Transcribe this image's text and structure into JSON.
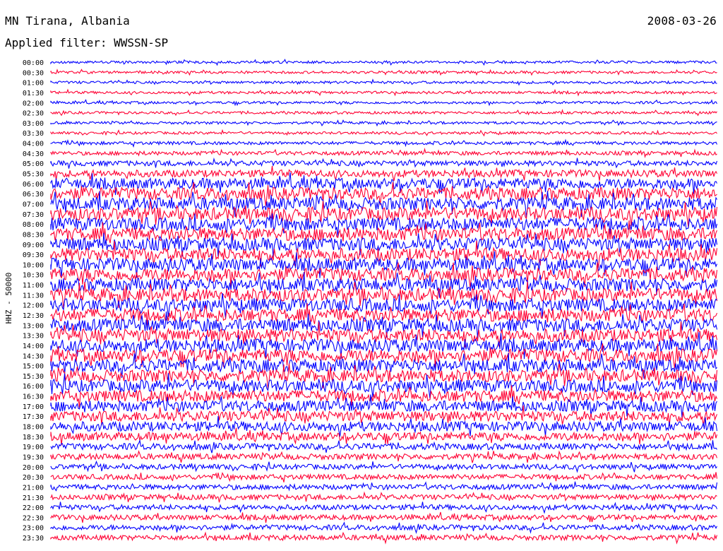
{
  "header": {
    "station": "MN Tirana, Albania",
    "date": "2008-03-26",
    "filter": "Applied filter: WWSSN-SP"
  },
  "chart_data": {
    "type": "helicorder",
    "channel_label": "HHZ - 50000",
    "row_labels": [
      "00:00",
      "00:30",
      "01:00",
      "01:30",
      "02:00",
      "02:30",
      "03:00",
      "03:30",
      "04:00",
      "04:30",
      "05:00",
      "05:30",
      "06:00",
      "06:30",
      "07:00",
      "07:30",
      "08:00",
      "08:30",
      "09:00",
      "09:30",
      "10:00",
      "10:30",
      "11:00",
      "11:30",
      "12:00",
      "12:30",
      "13:00",
      "13:30",
      "14:00",
      "14:30",
      "15:00",
      "15:30",
      "16:00",
      "16:30",
      "17:00",
      "17:30",
      "18:00",
      "18:30",
      "19:00",
      "19:30",
      "20:00",
      "20:30",
      "21:00",
      "21:30",
      "22:00",
      "22:30",
      "23:00",
      "23:30"
    ],
    "colors": [
      "#0000ff",
      "#ff0033"
    ],
    "relative_amplitude": [
      0.2,
      0.2,
      0.2,
      0.2,
      0.2,
      0.2,
      0.2,
      0.2,
      0.25,
      0.3,
      0.4,
      0.55,
      0.85,
      0.95,
      1.0,
      1.0,
      1.0,
      1.0,
      1.0,
      1.0,
      1.0,
      1.0,
      1.0,
      1.0,
      1.0,
      1.0,
      1.0,
      1.0,
      1.0,
      1.0,
      1.0,
      0.95,
      0.95,
      0.9,
      0.85,
      0.8,
      0.75,
      0.65,
      0.5,
      0.45,
      0.4,
      0.4,
      0.4,
      0.4,
      0.4,
      0.4,
      0.4,
      0.4
    ]
  }
}
